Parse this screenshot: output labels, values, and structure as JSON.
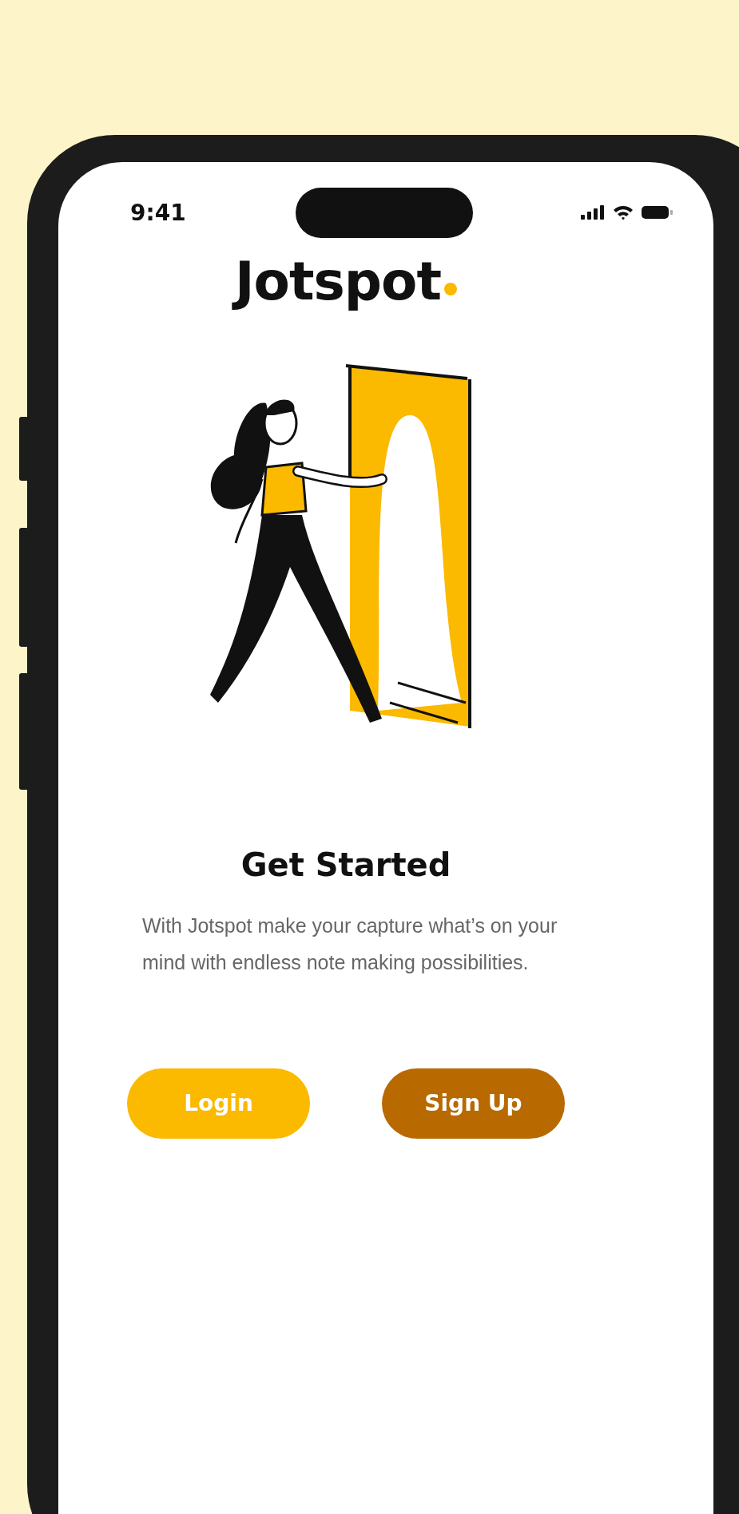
{
  "status_bar": {
    "time": "9:41"
  },
  "logo": {
    "text": "Jotspot"
  },
  "heading": "Get Started",
  "description": "With Jotspot make your capture what’s on your mind with endless note making possibilities.",
  "buttons": [
    {
      "label": "Login",
      "kind": "primary"
    },
    {
      "label": "Sign Up",
      "kind": "secondary"
    }
  ]
}
